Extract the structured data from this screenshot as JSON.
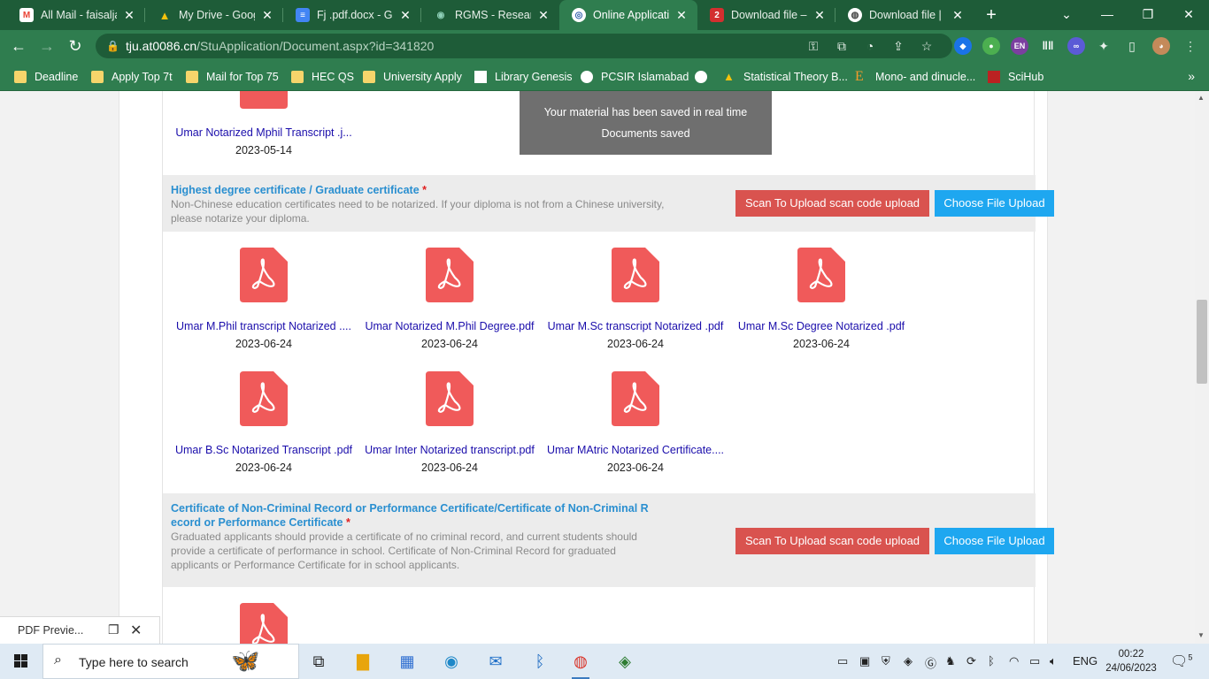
{
  "browser": {
    "tabs": [
      {
        "title": "All Mail - faisaljan",
        "icon": "gmail-icon",
        "color": "#ea4335",
        "glyph": "M"
      },
      {
        "title": "My Drive - Google",
        "icon": "drive-icon",
        "color": "#1fa463",
        "glyph": "▲"
      },
      {
        "title": "Fj .pdf.docx - Goo",
        "icon": "docs-icon",
        "color": "#4285f4",
        "glyph": "≡"
      },
      {
        "title": "RGMS - Research",
        "icon": "rgms-icon",
        "color": "#2e7d6b",
        "glyph": "◉"
      },
      {
        "title": "Online Applicatio",
        "icon": "university-seal-icon",
        "color": "#2b5aa8",
        "glyph": "◎"
      },
      {
        "title": "Download file – y",
        "icon": "download-2-icon",
        "color": "#d32f2f",
        "glyph": "2"
      },
      {
        "title": "Download file | iL",
        "icon": "globe-icon",
        "color": "#444444",
        "glyph": "◍"
      }
    ],
    "url_host": "tju.at0086.cn",
    "url_path": "/StuApplication/Document.aspx?id=341820",
    "extensions": [
      {
        "name": "ext-blue-icon",
        "color": "#1a73e8",
        "label": "◆"
      },
      {
        "name": "ext-color-icon",
        "color": "#4caf50",
        "label": "●"
      },
      {
        "name": "ext-en-icon",
        "color": "#7b3fa0",
        "label": "EN"
      },
      {
        "name": "ext-equalizer-icon",
        "color": "#2f7d4f",
        "label": "‖‖"
      },
      {
        "name": "ext-infinity-icon",
        "color": "#5b5bd6",
        "label": "∞"
      }
    ]
  },
  "bookmarks": [
    {
      "label": "Deadline",
      "icon": "folder-icon"
    },
    {
      "label": "Apply Top 7t",
      "icon": "folder-icon"
    },
    {
      "label": "Mail for Top 75",
      "icon": "folder-icon"
    },
    {
      "label": "HEC QS",
      "icon": "folder-icon"
    },
    {
      "label": "University Apply",
      "icon": "folder-icon"
    },
    {
      "label": "Library Genesis",
      "icon": "library-icon"
    },
    {
      "label": "PCSIR Islamabad",
      "icon": "globe-icon"
    },
    {
      "label": "",
      "icon": "globe-icon"
    },
    {
      "label": "Statistical Theory B...",
      "icon": "drive-icon"
    },
    {
      "label": "Mono- and dinucle...",
      "icon": "elsevier-icon"
    },
    {
      "label": "SciHub",
      "icon": "scihub-icon"
    }
  ],
  "toast": {
    "line1": "Your material has been saved in real time",
    "line2": "Documents saved"
  },
  "top_file": {
    "name": "Umar Notarized Mphil Transcript .j...",
    "date": "2023-05-14"
  },
  "sections": [
    {
      "title": "Highest degree certificate / Graduate certificate",
      "required_mark": "*",
      "description": "Non-Chinese education certificates need to be notarized. If your diploma is not from a Chinese university, please notarize your diploma.",
      "scan_button": "Scan To Upload scan code upload",
      "choose_button": "Choose File Upload",
      "files": [
        {
          "name": "Umar M.Phil transcript Notarized ....",
          "date": "2023-06-24"
        },
        {
          "name": "Umar Notarized M.Phil Degree.pdf",
          "date": "2023-06-24"
        },
        {
          "name": "Umar M.Sc transcript Notarized .pdf",
          "date": "2023-06-24"
        },
        {
          "name": "Umar M.Sc Degree Notarized .pdf",
          "date": "2023-06-24"
        },
        {
          "name": "Umar B.Sc Notarized Transcript .pdf",
          "date": "2023-06-24"
        },
        {
          "name": "Umar Inter Notarized transcript.pdf",
          "date": "2023-06-24"
        },
        {
          "name": "Umar MAtric Notarized Certificate....",
          "date": "2023-06-24"
        }
      ]
    },
    {
      "title_line1": "Certificate of Non-Criminal Record or Performance Certificate/Certificate of Non-Criminal R",
      "title_line2": "ecord or Performance Certificate",
      "required_mark": "*",
      "description": "Graduated applicants should provide a certificate of no criminal record, and current students should provide a certificate of performance in school. Certificate of Non-Criminal Record for graduated applicants or Performance Certificate for in school applicants.",
      "scan_button": "Scan To Upload scan code upload",
      "choose_button": "Choose File Upload"
    }
  ],
  "download_bar": {
    "label": "PDF Previe..."
  },
  "taskbar": {
    "search_placeholder": "Type here to search",
    "language": "ENG",
    "time": "00:22",
    "date": "24/06/2023",
    "notification_count": "5"
  },
  "colors": {
    "browser_frame": "#1e5c38",
    "browser_toolbar": "#2f7d4f",
    "pdf_red": "#f05a5a",
    "link_blue": "#1a0dab",
    "section_title_blue": "#2a8fd0",
    "scan_button_red": "#d9534f",
    "choose_button_blue": "#1ea7f0"
  }
}
